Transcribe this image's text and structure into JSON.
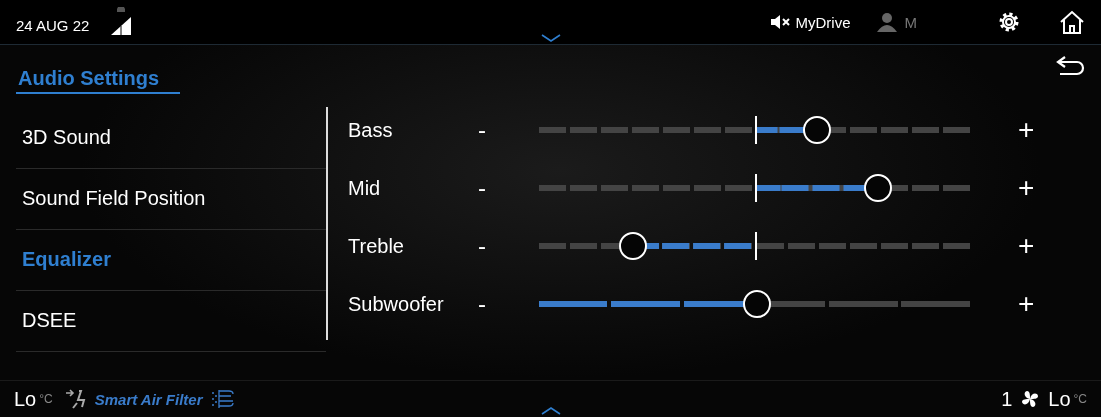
{
  "status_bar": {
    "date": "24 AUG 22",
    "muted": true,
    "profile": "MyDrive",
    "user": "M"
  },
  "panel": {
    "title": "Audio Settings"
  },
  "menu": [
    {
      "label": "3D Sound",
      "selected": false
    },
    {
      "label": "Sound Field Position",
      "selected": false
    },
    {
      "label": "Equalizer",
      "selected": true
    },
    {
      "label": "DSEE",
      "selected": false
    }
  ],
  "sliders": [
    {
      "kind": "centered",
      "label": "Bass",
      "decrease": "-",
      "increase": "+",
      "level": 0.64
    },
    {
      "kind": "centered",
      "label": "Mid",
      "decrease": "-",
      "increase": "+",
      "level": 0.78
    },
    {
      "kind": "centered",
      "label": "Treble",
      "decrease": "-",
      "increase": "+",
      "level": 0.216
    },
    {
      "kind": "plain",
      "label": "Subwoofer",
      "decrease": "-",
      "increase": "+",
      "level": 0.5
    }
  ],
  "climate": {
    "left_temp": "Lo",
    "left_unit": "°C",
    "filter": "Smart Air Filter",
    "fan_speed": "1",
    "right_temp": "Lo",
    "right_unit": "°C"
  }
}
